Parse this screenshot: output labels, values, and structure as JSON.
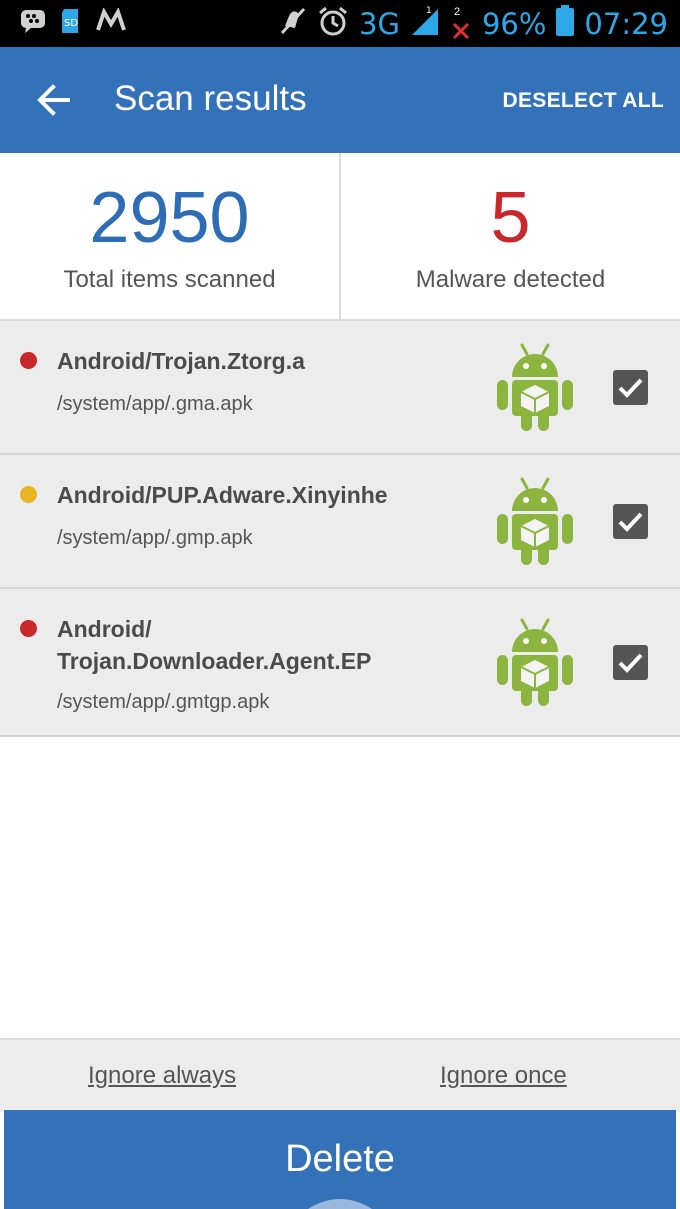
{
  "status_bar": {
    "network": "3G",
    "sim_indicator": "2",
    "battery": "96%",
    "time": "07:29",
    "icons": [
      "bbm-icon",
      "sd-card-icon",
      "signal-app-icon",
      "mute-icon",
      "alarm-icon",
      "signal-strength-icon",
      "no-signal-icon",
      "battery-icon"
    ]
  },
  "app_bar": {
    "title": "Scan results",
    "action": "DESELECT ALL",
    "back_icon": "arrow-back-icon"
  },
  "stats": {
    "total": {
      "value": "2950",
      "label": "Total items scanned"
    },
    "malware": {
      "value": "5",
      "label": "Malware detected"
    }
  },
  "results": [
    {
      "name_lines": [
        "Android/Trojan.Ztorg.a"
      ],
      "path": "/system/app/.gma.apk",
      "severity_color": "#c8282b",
      "checked": true
    },
    {
      "name_lines": [
        "Android/PUP.Adware.Xinyinhe"
      ],
      "path": "/system/app/.gmp.apk",
      "severity_color": "#e6b523",
      "checked": true
    },
    {
      "name_lines": [
        "Android/",
        "Trojan.Downloader.Agent.EP"
      ],
      "path": "/system/app/.gmtgp.apk",
      "severity_color": "#c8282b",
      "checked": true
    }
  ],
  "actions": {
    "ignore_always": "Ignore always",
    "ignore_once": "Ignore once",
    "delete": "Delete"
  },
  "colors": {
    "primary": "#3372b9",
    "danger": "#c8282b",
    "warning": "#e6b523",
    "android_green": "#8cb53f"
  }
}
